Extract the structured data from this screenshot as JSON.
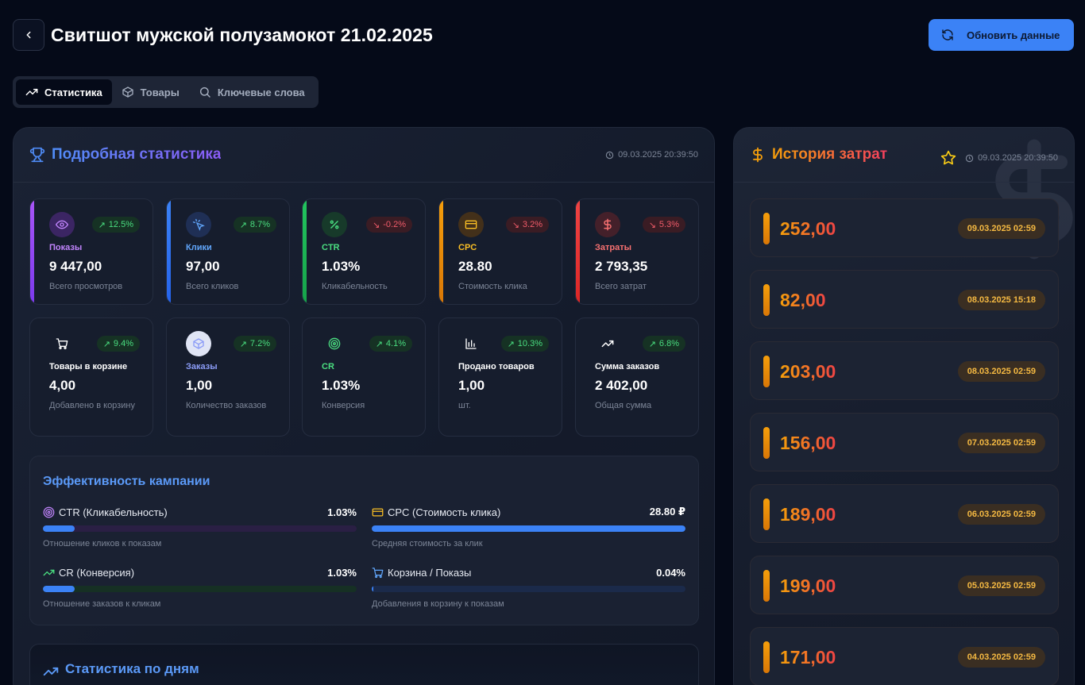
{
  "header": {
    "title": "Свитшот мужской полузамокот 21.02.2025",
    "refresh_label": "Обновить данные"
  },
  "tabs": [
    {
      "label": "Статистика",
      "icon": "trending-up-icon",
      "active": true
    },
    {
      "label": "Товары",
      "icon": "package-icon",
      "active": false
    },
    {
      "label": "Ключевые слова",
      "icon": "search-icon",
      "active": false
    }
  ],
  "stats_panel": {
    "title": "Подробная статистика",
    "timestamp": "09.03.2025 20:39:50",
    "cards": [
      {
        "label": "Показы",
        "value": "9 447,00",
        "sub": "Всего просмотров",
        "change": "12.5%",
        "dir": "up",
        "icon": "eye-icon",
        "color": "#a855f7"
      },
      {
        "label": "Клики",
        "value": "97,00",
        "sub": "Всего кликов",
        "change": "8.7%",
        "dir": "up",
        "icon": "cursor-click-icon",
        "color": "#3b82f6"
      },
      {
        "label": "CTR",
        "value": "1.03%",
        "sub": "Кликабельность",
        "change": "-0.2%",
        "dir": "down",
        "icon": "percent-icon",
        "color": "#22c55e"
      },
      {
        "label": "CPC",
        "value": "28.80",
        "sub": "Стоимость клика",
        "change": "3.2%",
        "dir": "down",
        "icon": "credit-card-icon",
        "color": "#f59e0b"
      },
      {
        "label": "Затраты",
        "value": "2 793,35",
        "sub": "Всего затрат",
        "change": "5.3%",
        "dir": "down",
        "icon": "dollar-icon",
        "color": "#ef4444"
      },
      {
        "label": "Товары в корзине",
        "value": "4,00",
        "sub": "Добавлено в корзину",
        "change": "9.4%",
        "dir": "up",
        "icon": "cart-icon",
        "color": "#ffffff"
      },
      {
        "label": "Заказы",
        "value": "1,00",
        "sub": "Количество заказов",
        "change": "7.2%",
        "dir": "up",
        "icon": "package-icon",
        "color": "#8b9cf7"
      },
      {
        "label": "CR",
        "value": "1.03%",
        "sub": "Конверсия",
        "change": "4.1%",
        "dir": "up",
        "icon": "target-icon",
        "color": "#22c55e"
      },
      {
        "label": "Продано товаров",
        "value": "1,00",
        "sub": "шт.",
        "change": "10.3%",
        "dir": "up",
        "icon": "bar-chart-icon",
        "color": "#ffffff"
      },
      {
        "label": "Сумма заказов",
        "value": "2 402,00",
        "sub": "Общая сумма",
        "change": "6.8%",
        "dir": "up",
        "icon": "trending-up-icon",
        "color": "#ffffff"
      }
    ]
  },
  "efficiency": {
    "title": "Эффективность кампании",
    "metrics": [
      {
        "name": "CTR (Кликабельность)",
        "value": "1.03%",
        "desc": "Отношение кликов к показам",
        "fill_pct": 10,
        "icon": "target-icon",
        "track": "#2a1f44"
      },
      {
        "name": "CPC (Стоимость клика)",
        "value": "28.80 ₽",
        "desc": "Средняя стоимость за клик",
        "fill_pct": 100,
        "icon": "credit-card-icon",
        "track": "#1e2a44"
      },
      {
        "name": "CR (Конверсия)",
        "value": "1.03%",
        "desc": "Отношение заказов к кликам",
        "fill_pct": 10,
        "icon": "trending-up-icon",
        "track": "#163024"
      },
      {
        "name": "Корзина / Показы",
        "value": "0.04%",
        "desc": "Добавления в корзину к показам",
        "fill_pct": 0.4,
        "icon": "cart-icon",
        "track": "#1b2a4a"
      }
    ]
  },
  "daily": {
    "title": "Статистика по дням"
  },
  "cost_history": {
    "title": "История затрат",
    "timestamp": "09.03.2025 20:39:50",
    "items": [
      {
        "amount": "252,00",
        "date": "09.03.2025 02:59"
      },
      {
        "amount": "82,00",
        "date": "08.03.2025 15:18"
      },
      {
        "amount": "203,00",
        "date": "08.03.2025 02:59"
      },
      {
        "amount": "156,00",
        "date": "07.03.2025 02:59"
      },
      {
        "amount": "189,00",
        "date": "06.03.2025 02:59"
      },
      {
        "amount": "199,00",
        "date": "05.03.2025 02:59"
      },
      {
        "amount": "171,00",
        "date": "04.03.2025 02:59"
      }
    ]
  }
}
